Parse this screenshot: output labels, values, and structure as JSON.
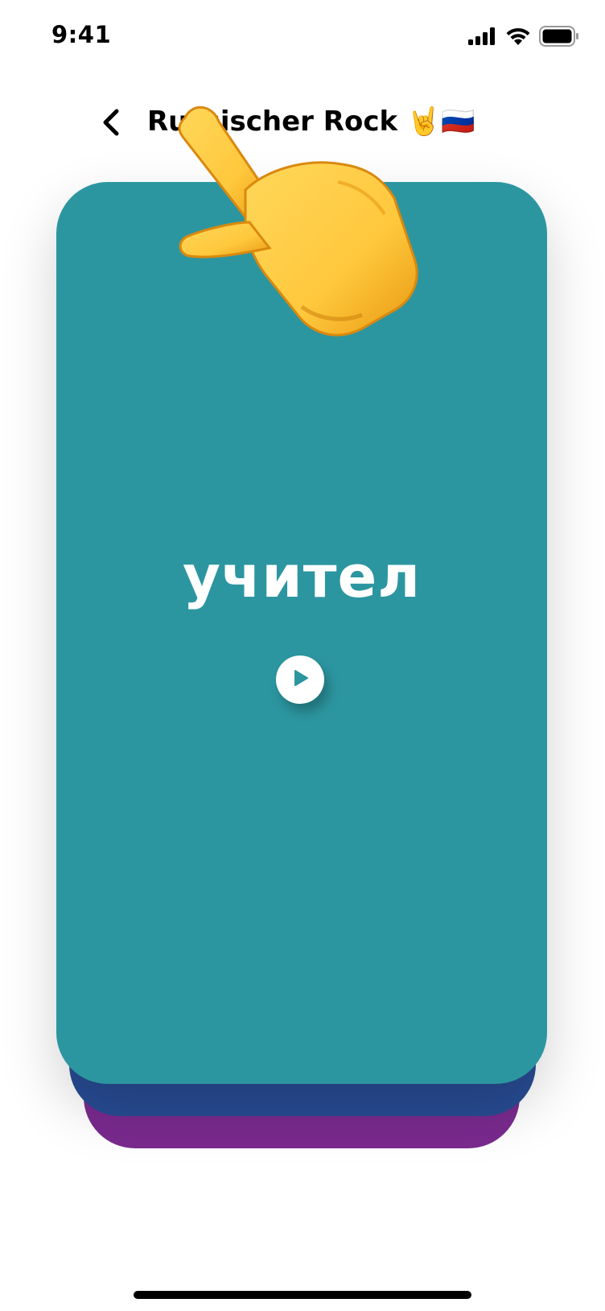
{
  "status_bar": {
    "time": "9:41",
    "icons": [
      "cellular-signal-icon",
      "wifi-icon",
      "battery-icon"
    ]
  },
  "header": {
    "back_icon": "chevron-left-icon",
    "title": "Russischer Rock 🤘🇷🇺"
  },
  "card": {
    "word": "учител",
    "play_icon": "play-icon"
  },
  "overlay": {
    "icon": "pointing-hand-icon"
  },
  "colors": {
    "card_front": "#2C96A0",
    "card_back_1": "#284C94",
    "card_back_2": "#7A2A8E",
    "hand_yellow": "#FFC83D"
  }
}
